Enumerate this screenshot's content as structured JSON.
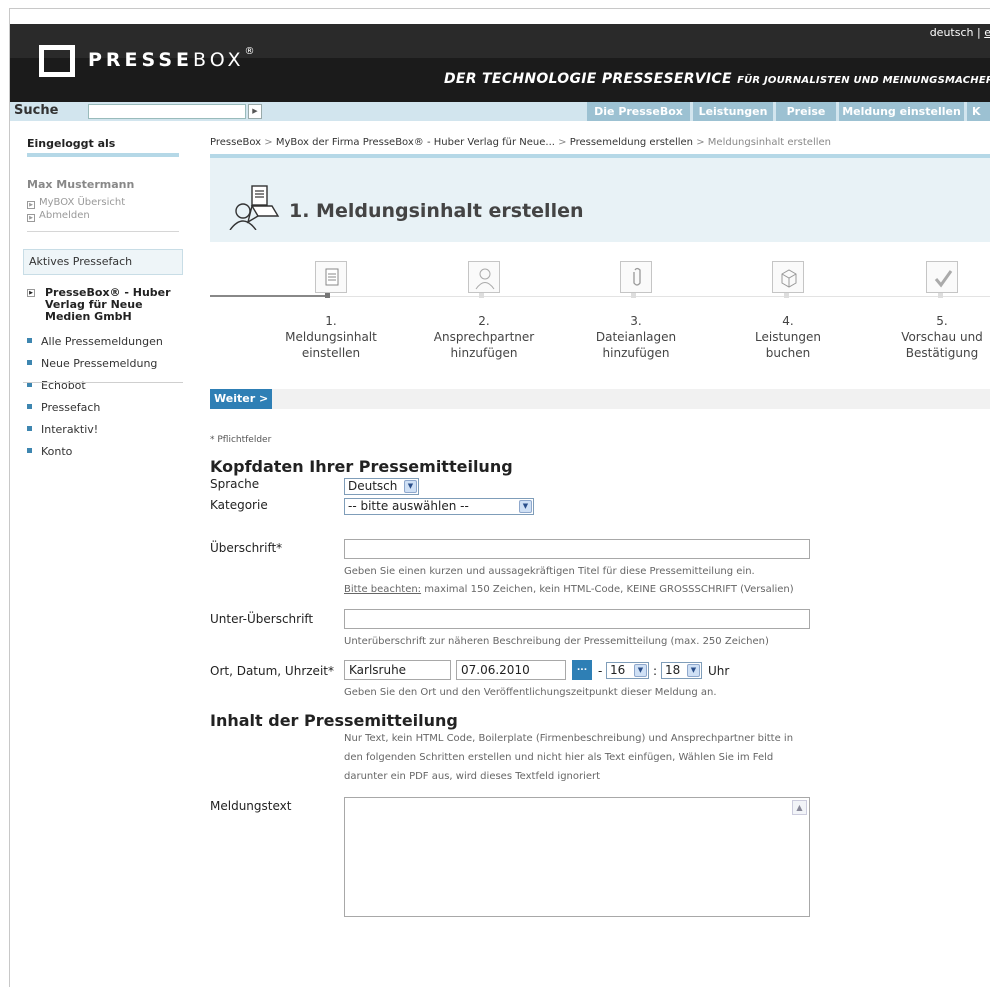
{
  "header": {
    "logo_bold": "PRESSE",
    "logo_regular": "BOX",
    "logo_reg": "®",
    "lang_de": "deutsch",
    "lang_sep": "|",
    "lang_en": "e",
    "slogan_main": "DER TECHNOLOGIE PRESSESERVICE",
    "slogan_small": "FÜR JOURNALISTEN UND MEINUNGSMACHER"
  },
  "search": {
    "label": "Suche",
    "go": "▶"
  },
  "nav": {
    "tabs": [
      "Die PresseBox",
      "Leistungen",
      "Preise",
      "Meldung einstellen",
      "K"
    ]
  },
  "sidebar": {
    "logged_in_head": "Eingeloggt als",
    "user_name": "Max Mustermann",
    "user_links": [
      "MyBOX Übersicht",
      "Abmelden"
    ],
    "box_title": "Aktives Pressefach",
    "company": "PresseBox® - Huber Verlag für Neue Medien GmbH",
    "items": [
      "Alle Pressemeldungen",
      "Neue Pressemeldung",
      "Echobot",
      "Pressefach",
      "Interaktiv!",
      "Konto"
    ]
  },
  "breadcrumb": {
    "items": [
      "PresseBox",
      "MyBox der Firma PresseBox® - Huber Verlag für Neue...",
      "Pressemeldung erstellen"
    ],
    "current": "Meldungsinhalt erstellen",
    "separator": ">"
  },
  "page": {
    "title": "1. Meldungsinhalt erstellen"
  },
  "steps": [
    {
      "num": "1.",
      "line1": "Meldungsinhalt",
      "line2": "einstellen"
    },
    {
      "num": "2.",
      "line1": "Ansprechpartner",
      "line2": "hinzufügen"
    },
    {
      "num": "3.",
      "line1": "Dateianlagen",
      "line2": "hinzufügen"
    },
    {
      "num": "4.",
      "line1": "Leistungen",
      "line2": "buchen"
    },
    {
      "num": "5.",
      "line1": "Vorschau und",
      "line2": "Bestätigung"
    }
  ],
  "form": {
    "weiter": "Weiter >",
    "required_note": "* Pflichtfelder",
    "section_head": "Kopfdaten Ihrer Pressemitteilung",
    "sprache_label": "Sprache",
    "sprache_value": "Deutsch",
    "kategorie_label": "Kategorie",
    "kategorie_value": "-- bitte auswählen --",
    "ueberschrift_label": "Überschrift*",
    "ueberschrift_value": "",
    "ueberschrift_hint1": "Geben Sie einen kurzen und aussagekräftigen Titel für diese Pressemitteilung ein.",
    "ueberschrift_hint2_u": "Bitte beachten:",
    "ueberschrift_hint2": " maximal 150 Zeichen, kein HTML-Code, KEINE GROSSSCHRIFT (Versalien)",
    "unter_label": "Unter-Überschrift",
    "unter_value": "",
    "unter_hint": "Unterüberschrift zur näheren Beschreibung der Pressemitteilung (max. 250 Zeichen)",
    "ort_label": "Ort, Datum, Uhrzeit*",
    "ort_value": "Karlsruhe",
    "datum_value": "07.06.2010",
    "cal_btn": "...",
    "dash": "-",
    "hour_value": "16",
    "colon": ":",
    "minute_value": "18",
    "uhr": "Uhr",
    "ort_hint": "Geben Sie den Ort und den Veröffentlichungszeitpunkt dieser Meldung an.",
    "inhalt_head": "Inhalt der Pressemitteilung",
    "inhalt_hint1": "Nur Text, kein HTML Code, Boilerplate (Firmenbeschreibung) und Ansprechpartner bitte in",
    "inhalt_hint2": "den folgenden Schritten erstellen und nicht hier als Text einfügen, Wählen Sie im Feld",
    "inhalt_hint3": "darunter ein PDF aus, wird dieses Textfeld ignoriert",
    "meldungstext_label": "Meldungstext",
    "meldungstext_value": ""
  },
  "icons": {
    "dropdown": "chevron-down-icon",
    "scroll_up": "scroll-up-icon",
    "calendar": "calendar-icon"
  }
}
